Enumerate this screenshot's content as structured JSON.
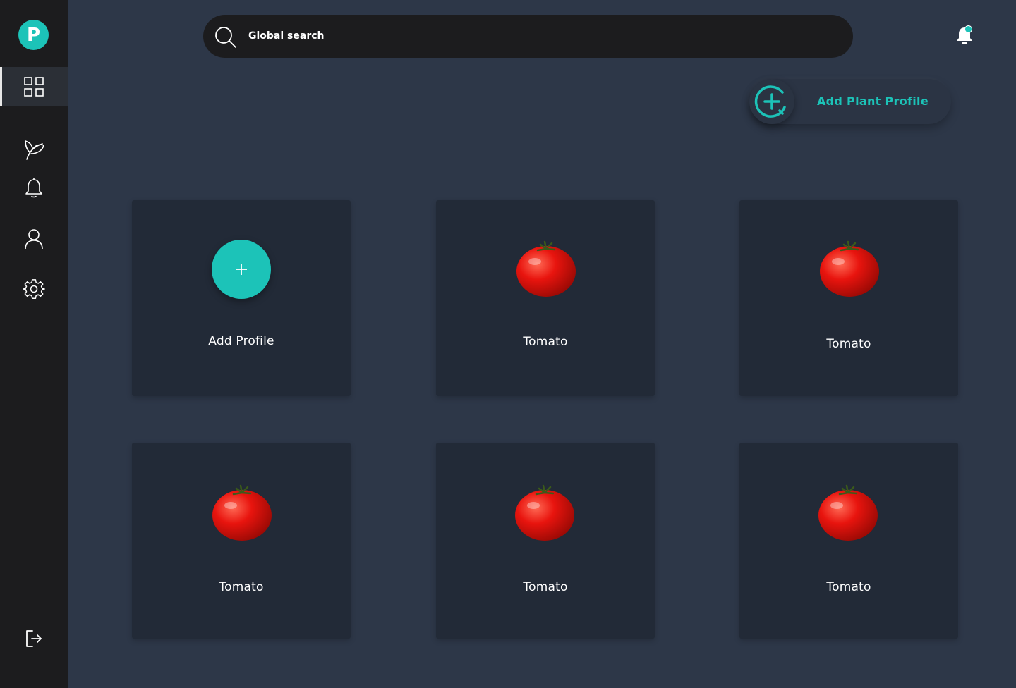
{
  "app": {
    "logo_letter": "P",
    "accent_color": "#1cc3b8"
  },
  "sidebar": {
    "items": [
      {
        "name": "dashboard",
        "icon": "grid-icon",
        "active": true
      },
      {
        "name": "plants",
        "icon": "leaf-icon",
        "active": false
      },
      {
        "name": "notifications",
        "icon": "bell-icon",
        "active": false
      },
      {
        "name": "profile",
        "icon": "user-icon",
        "active": false
      },
      {
        "name": "settings",
        "icon": "gear-icon",
        "active": false
      }
    ],
    "logout_icon": "logout-icon"
  },
  "header": {
    "search_placeholder": "Global search",
    "notification_badge": true
  },
  "actions": {
    "add_plant_label": "Add Plant Profile"
  },
  "cards": [
    {
      "type": "add",
      "label": "Add Profile"
    },
    {
      "type": "plant",
      "label": "Tomato",
      "icon": "tomato-image"
    },
    {
      "type": "plant",
      "label": "Tomato",
      "icon": "tomato-image"
    },
    {
      "type": "plant",
      "label": "Tomato",
      "icon": "tomato-image"
    },
    {
      "type": "plant",
      "label": "Tomato",
      "icon": "tomato-image"
    },
    {
      "type": "plant",
      "label": "Tomato",
      "icon": "tomato-image"
    }
  ]
}
